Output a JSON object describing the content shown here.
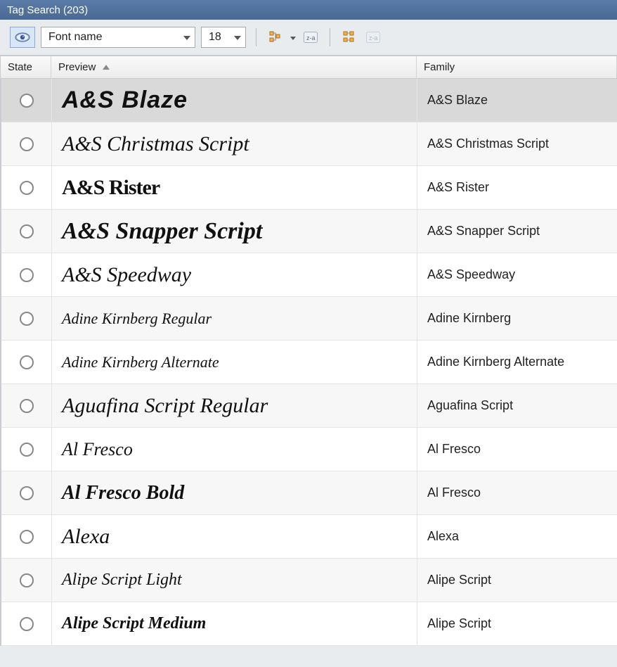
{
  "title": "Tag Search (203)",
  "toolbar": {
    "preview_text": "Font name",
    "font_size": "18"
  },
  "columns": {
    "state": "State",
    "preview": "Preview",
    "family": "Family"
  },
  "rows": [
    {
      "preview": "A&S Blaze",
      "family": "A&S Blaze",
      "selected": true,
      "klass": "f-blaze"
    },
    {
      "preview": "A&S Christmas Script",
      "family": "A&S Christmas Script",
      "selected": false,
      "klass": "f-xmas"
    },
    {
      "preview": "A&S Rister",
      "family": "A&S Rister",
      "selected": false,
      "klass": "f-rister"
    },
    {
      "preview": "A&S Snapper Script",
      "family": "A&S Snapper Script",
      "selected": false,
      "klass": "f-snapper"
    },
    {
      "preview": "A&S Speedway",
      "family": "A&S Speedway",
      "selected": false,
      "klass": "f-speedway"
    },
    {
      "preview": "Adine Kirnberg Regular",
      "family": "Adine Kirnberg",
      "selected": false,
      "klass": "f-adine"
    },
    {
      "preview": "Adine Kirnberg Alternate",
      "family": "Adine Kirnberg Alternate",
      "selected": false,
      "klass": "f-adine"
    },
    {
      "preview": "Aguafina Script Regular",
      "family": "Aguafina Script",
      "selected": false,
      "klass": "f-aguafina"
    },
    {
      "preview": "Al Fresco",
      "family": "Al Fresco",
      "selected": false,
      "klass": "f-alfresco"
    },
    {
      "preview": "Al Fresco Bold",
      "family": "Al Fresco",
      "selected": false,
      "klass": "f-alfrescoB"
    },
    {
      "preview": "Alexa",
      "family": "Alexa",
      "selected": false,
      "klass": "f-alexa"
    },
    {
      "preview": "Alipe Script Light",
      "family": "Alipe Script",
      "selected": false,
      "klass": "f-alipeL"
    },
    {
      "preview": "Alipe Script Medium",
      "family": "Alipe Script",
      "selected": false,
      "klass": "f-alipeM"
    }
  ]
}
